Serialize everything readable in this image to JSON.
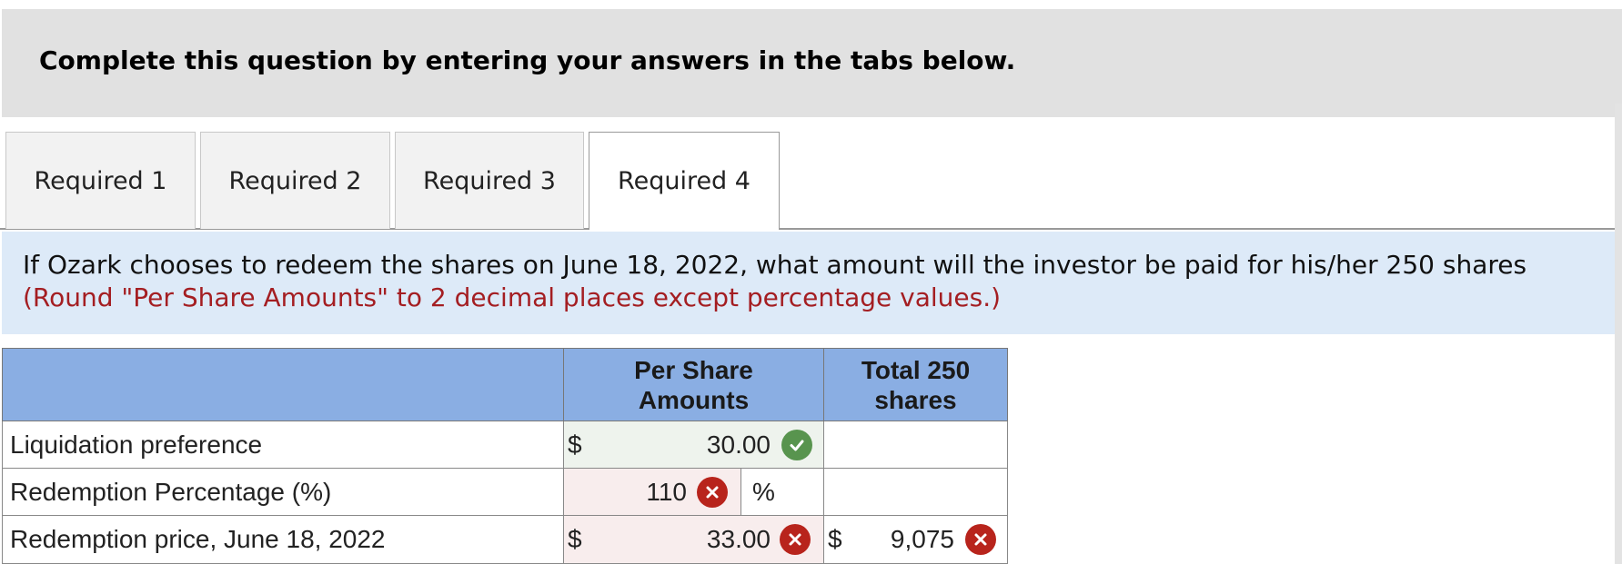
{
  "banner": {
    "title": "Complete this question by entering your answers in the tabs below."
  },
  "tabs": [
    {
      "label": "Required 1",
      "active": false
    },
    {
      "label": "Required 2",
      "active": false
    },
    {
      "label": "Required 3",
      "active": false
    },
    {
      "label": "Required 4",
      "active": true
    }
  ],
  "question": {
    "text": "If Ozark chooses to redeem the shares on June 18, 2022, what amount will the investor be paid for his/her 250 shares",
    "note": "(Round \"Per Share Amounts\" to 2 decimal places except percentage values.)"
  },
  "table": {
    "headers": {
      "per_share": "Per Share Amounts",
      "total": "Total 250 shares"
    },
    "rows": [
      {
        "label": "Liquidation preference",
        "per_share_prefix": "$",
        "per_share_value": "30.00",
        "per_share_status": "correct"
      },
      {
        "label": "Redemption Percentage (%)",
        "per_share_value": "110",
        "per_share_status": "incorrect",
        "suffix": "%"
      },
      {
        "label": "Redemption price, June 18, 2022",
        "per_share_prefix": "$",
        "per_share_value": "33.00",
        "per_share_status": "incorrect",
        "total_prefix": "$",
        "total_value": "9,075",
        "total_status": "incorrect"
      }
    ]
  },
  "colors": {
    "header_bg": "#8aaee3",
    "question_bg": "#ddeaf8",
    "note_red": "#a41e22",
    "correct_green": "#58944e",
    "incorrect_red": "#b8241c"
  },
  "icons": {
    "correct": "check-circle-icon",
    "incorrect": "x-circle-icon"
  }
}
